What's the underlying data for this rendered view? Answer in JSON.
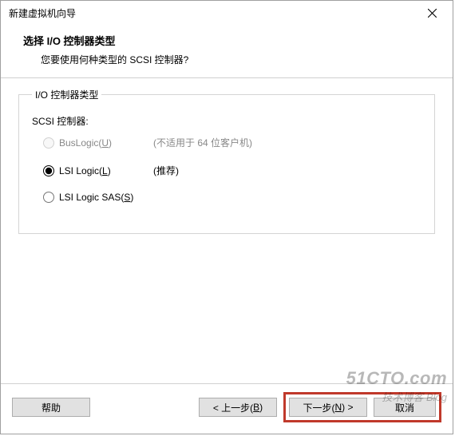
{
  "window": {
    "title": "新建虚拟机向导"
  },
  "header": {
    "title": "选择 I/O 控制器类型",
    "subtitle": "您要使用何种类型的 SCSI 控制器?"
  },
  "group": {
    "legend": "I/O 控制器类型",
    "scsi_label": "SCSI 控制器:",
    "options": [
      {
        "label": "BusLogic(",
        "accel": "U",
        "tail": ")",
        "hint": "(不适用于 64 位客户机)",
        "checked": false,
        "disabled": true
      },
      {
        "label": "LSI Logic(",
        "accel": "L",
        "tail": ")",
        "hint": "(推荐)",
        "checked": true,
        "disabled": false
      },
      {
        "label": "LSI Logic SAS(",
        "accel": "S",
        "tail": ")",
        "hint": "",
        "checked": false,
        "disabled": false
      }
    ]
  },
  "footer": {
    "help": "帮助",
    "back_prefix": "< 上一步(",
    "back_accel": "B",
    "back_suffix": ")",
    "next_prefix": "下一步(",
    "next_accel": "N",
    "next_suffix": ") >",
    "cancel": "取消"
  },
  "watermark": {
    "line1": "51CTO.com",
    "line2": "技术博客",
    "line2b": "Blog"
  }
}
